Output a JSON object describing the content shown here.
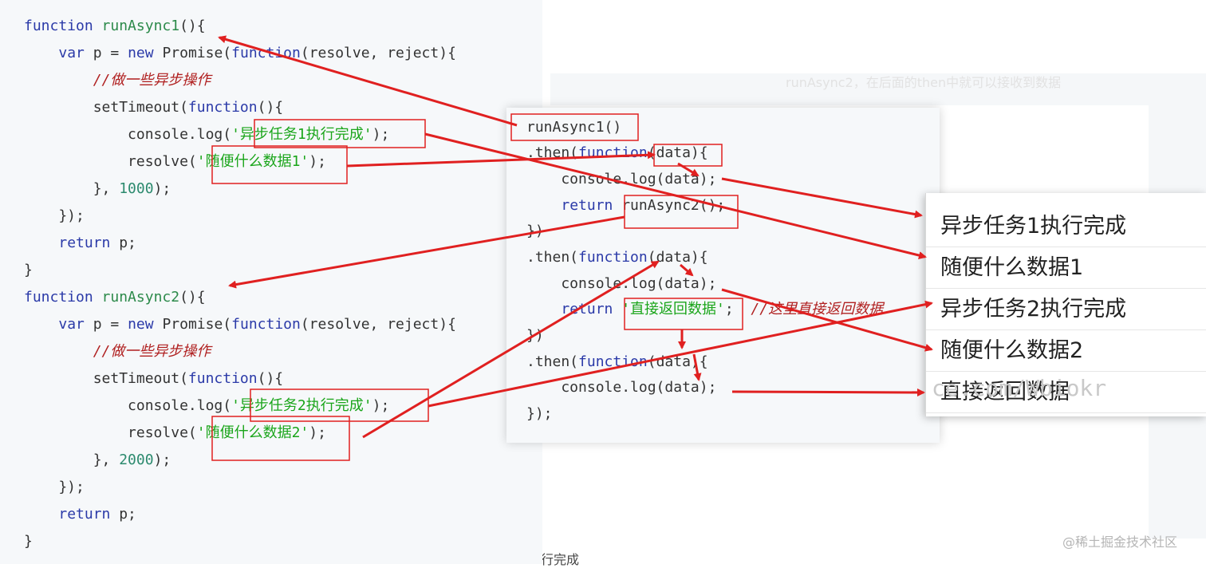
{
  "left_code": [
    "function runAsync1(){",
    "    var p = new Promise(function(resolve, reject){",
    "        //做一些异步操作",
    "        setTimeout(function(){",
    "            console.log('异步任务1执行完成');",
    "            resolve('随便什么数据1');",
    "        }, 1000);",
    "    });",
    "    return p;",
    "}",
    "function runAsync2(){",
    "    var p = new Promise(function(resolve, reject){",
    "        //做一些异步操作",
    "        setTimeout(function(){",
    "            console.log('异步任务2执行完成');",
    "            resolve('随便什么数据2');",
    "        }, 2000);",
    "    });",
    "    return p;",
    "}"
  ],
  "mid_code": [
    "runAsync1()",
    ".then(function(data){",
    "    console.log(data);",
    "    return runAsync2();",
    "})",
    ".then(function(data){",
    "    console.log(data);",
    "    return '直接返回数据';  //这里直接返回数据",
    "})",
    ".then(function(data){",
    "    console.log(data);",
    "});"
  ],
  "output": [
    "异步任务1执行完成",
    "随便什么数据1",
    "异步任务2执行完成",
    "随便什么数据2",
    "直接返回数据"
  ],
  "watermark_url": "ce.com/Wbiokr",
  "watermark": "@稀土掘金技术社区",
  "bottom_fragment": "行完成",
  "bg_text_1": "runAsync2，在后面的then中就可以接收到数据",
  "colors": {
    "arrow": "#e02020",
    "keyword": "#2b3aa8",
    "function": "#2c8a4a",
    "string": "#1aa51a",
    "comment": "#b02020"
  }
}
